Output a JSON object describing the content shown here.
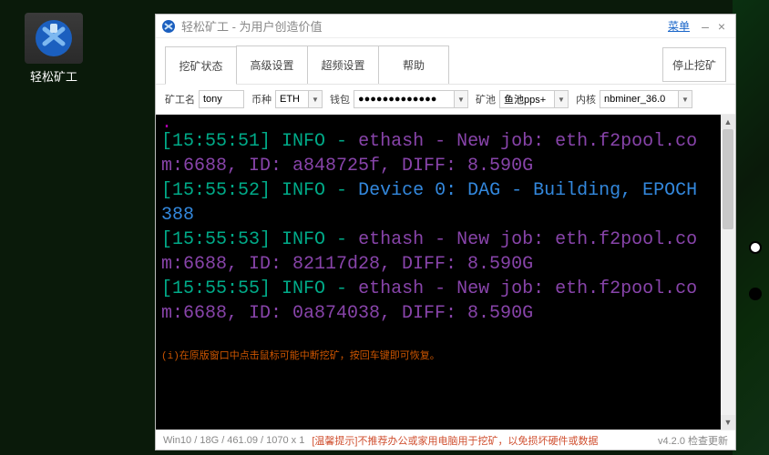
{
  "desktop": {
    "icon_label": "轻松矿工"
  },
  "window": {
    "title": "轻松矿工 - 为用户创造价值",
    "menu_label": "菜单"
  },
  "tabs": {
    "mining_status": "挖矿状态",
    "advanced_settings": "高级设置",
    "overclock_settings": "超频设置",
    "help": "帮助",
    "stop_mining": "停止挖矿"
  },
  "config": {
    "miner_name_label": "矿工名",
    "miner_name_value": "tony",
    "coin_label": "币种",
    "coin_value": "ETH",
    "wallet_label": "钱包",
    "wallet_value": "●●●●●●●●●●●●●",
    "pool_label": "矿池",
    "pool_value": "鱼池pps+",
    "kernel_label": "内核",
    "kernel_value": "nbminer_36.0"
  },
  "terminal": {
    "lines": [
      {
        "ts": "[15:55:51]",
        "info": "INFO -",
        "body_class": "eth",
        "body": "ethash - New job: eth.f2pool.com:6688, ID: a848725f, DIFF: 8.590G"
      },
      {
        "ts": "[15:55:52]",
        "info": "INFO -",
        "body_class": "dev",
        "body": "Device 0: DAG - Building, EPOCH 388"
      },
      {
        "ts": "[15:55:53]",
        "info": "INFO -",
        "body_class": "eth",
        "body": "ethash - New job: eth.f2pool.com:6688, ID: 82117d28, DIFF: 8.590G"
      },
      {
        "ts": "[15:55:55]",
        "info": "INFO -",
        "body_class": "eth",
        "body": "ethash - New job: eth.f2pool.com:6688, ID: 0a874038, DIFF: 8.590G"
      }
    ],
    "footer_warn": "(i)在原版窗口中点击鼠标可能中断挖矿，按回车键即可恢复。"
  },
  "status": {
    "sysinfo": "Win10 / 18G / 461.09 / 1070 x 1",
    "tip": "[温馨提示]不推荐办公或家用电脑用于挖矿，以免损坏硬件或数据",
    "version": "v4.2.0 检查更新"
  }
}
